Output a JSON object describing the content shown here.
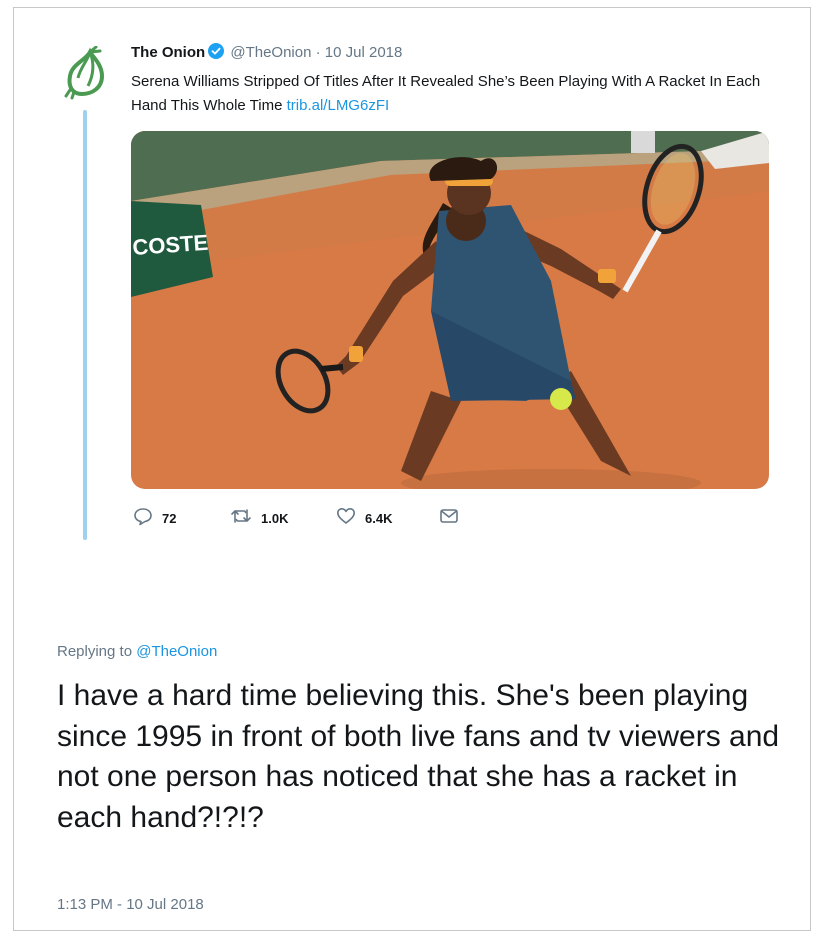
{
  "tweet": {
    "author_name": "The Onion",
    "handle": "@TheOnion",
    "separator": "·",
    "date": "10 Jul 2018",
    "text": "Serena Williams Stripped Of Titles After It Revealed She’s Been Playing With A Racket In Each Hand This Whole Time",
    "link": "trib.al/LMG6zFI",
    "media_sign_text": "COSTE",
    "stats": {
      "replies": "72",
      "retweets": "1.0K",
      "likes": "6.4K"
    }
  },
  "reply": {
    "replying_to_label": "Replying to",
    "replying_to_handle": "@TheOnion",
    "text": "I have a hard time believing this.  She's been playing since 1995 in front of both live fans and tv viewers and not one person has noticed that she has a racket in each hand?!?!?",
    "timestamp": "1:13 PM - 10 Jul 2018"
  },
  "colors": {
    "accent": "#1b95e0",
    "muted": "#657786",
    "thread_line": "#9fd0ee",
    "logo_green": "#4a9a52",
    "clay_court": "#d77a46"
  },
  "icons": [
    "onion-logo-icon",
    "verified-badge-icon",
    "reply-icon",
    "retweet-icon",
    "like-icon",
    "message-icon"
  ]
}
